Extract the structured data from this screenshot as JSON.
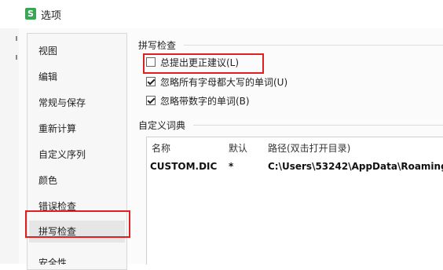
{
  "window": {
    "title": "选项",
    "icon": "wps-spreadsheet-icon"
  },
  "nav": {
    "items": [
      {
        "label": "视图"
      },
      {
        "label": "编辑"
      },
      {
        "label": "常规与保存"
      },
      {
        "label": "重新计算"
      },
      {
        "label": "自定义序列"
      },
      {
        "label": "颜色"
      },
      {
        "label": "错误检查"
      },
      {
        "label": "拼写检查"
      },
      {
        "label": "安全性"
      }
    ],
    "active": "拼写检查"
  },
  "spell_check": {
    "section_title": "拼写检查",
    "options": [
      {
        "label": "总提出更正建议(L)",
        "checked": false
      },
      {
        "label": "忽略所有字母都大写的单词(U)",
        "checked": true
      },
      {
        "label": "忽略带数字的单词(B)",
        "checked": true
      }
    ]
  },
  "custom_dictionary": {
    "section_title": "自定义词典",
    "columns": [
      "名称",
      "默认",
      "路径(双击打开目录)"
    ],
    "rows": [
      {
        "name": "CUSTOM.DIC",
        "default": "*",
        "path": "C:\\Users\\53242\\AppData\\Roaming"
      }
    ]
  },
  "colors": {
    "highlight": "#e02020",
    "check_accent": "#3aa655"
  }
}
